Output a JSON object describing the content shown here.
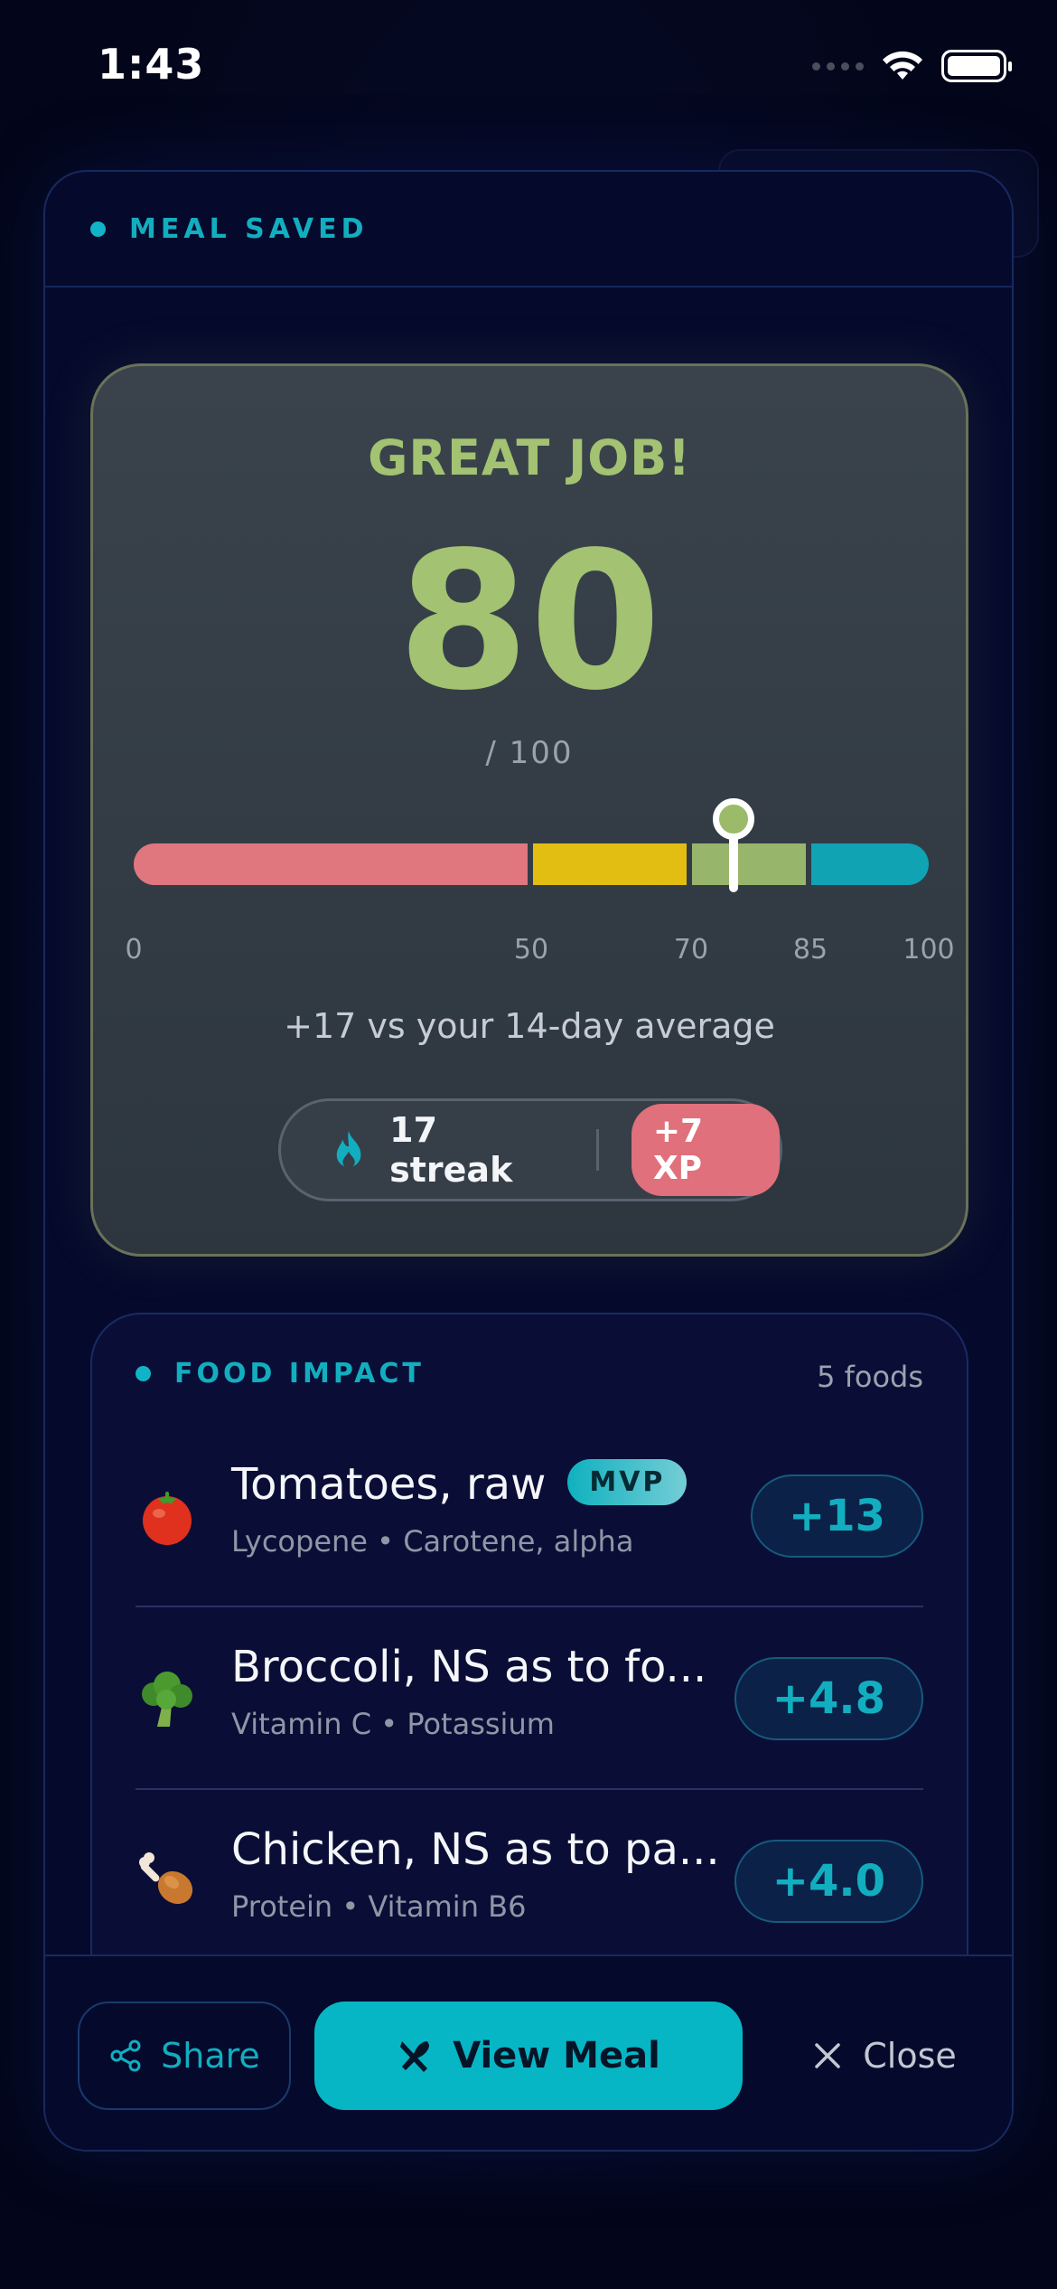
{
  "status_bar": {
    "time": "1:43"
  },
  "modal": {
    "header_title": "MEAL SAVED"
  },
  "score_card": {
    "headline": "GREAT JOB!",
    "score": "80",
    "score_max": "/ 100",
    "score_value": 80,
    "ticks": [
      "0",
      "50",
      "70",
      "85",
      "100"
    ],
    "comparison": "+17 vs your 14-day average",
    "streak_label": "17 streak",
    "xp_label": "+7 XP",
    "colors": {
      "poor": "#e0777f",
      "fair": "#e2bd12",
      "good": "#98b56c",
      "excellent": "#0fa3b4",
      "score": "#a3c272"
    }
  },
  "food_impact": {
    "title": "FOOD IMPACT",
    "count": "5 foods",
    "items": [
      {
        "icon": "tomato-icon",
        "name": "Tomatoes, raw",
        "badge": "MVP",
        "nutrients": "Lycopene • Carotene, alpha",
        "delta": "+13"
      },
      {
        "icon": "broccoli-icon",
        "name": "Broccoli, NS as to fo...",
        "nutrients": "Vitamin C • Potassium",
        "delta": "+4.8"
      },
      {
        "icon": "chicken-leg-icon",
        "name": "Chicken, NS as to pa...",
        "nutrients": "Protein • Vitamin B6",
        "delta": "+4.0"
      }
    ]
  },
  "footer": {
    "share_label": "Share",
    "view_label": "View Meal",
    "close_label": "Close"
  }
}
